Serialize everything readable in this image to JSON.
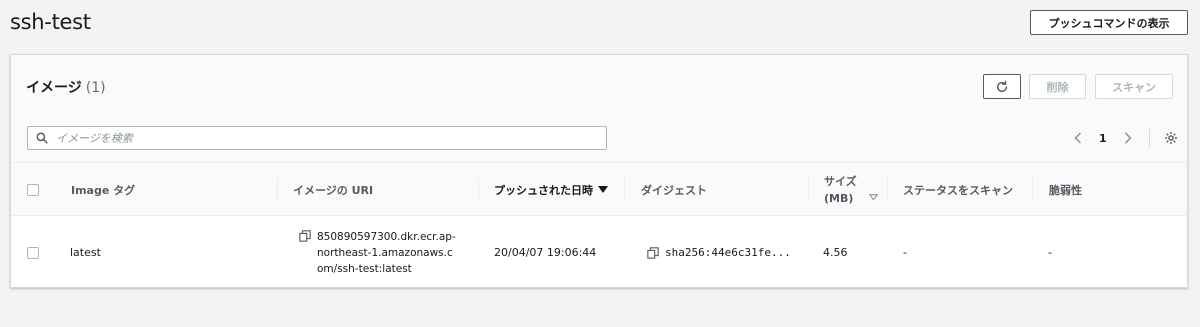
{
  "page": {
    "title": "ssh-test",
    "push_command_label": "プッシュコマンドの表示"
  },
  "panel": {
    "title": "イメージ",
    "count": "(1)",
    "delete_label": "削除",
    "scan_label": "スキャン",
    "search_placeholder": "イメージを検索",
    "page_number": "1"
  },
  "table": {
    "columns": {
      "image_tag": "Image タグ",
      "uri": "イメージの URI",
      "pushed_at": "プッシュされた日時",
      "digest": "ダイジェスト",
      "size_line1": "サイズ",
      "size_line2": "(MB)",
      "scan_status": "ステータスをスキャン",
      "vulnerabilities": "脆弱性"
    },
    "rows": [
      {
        "tag": "latest",
        "uri": "850890597300.dkr.ecr.ap-northeast-1.amazonaws.com/ssh-test:latest",
        "pushed_at": "20/04/07 19:06:44",
        "digest": "sha256:44e6c31fe...",
        "size": "4.56",
        "scan_status": "-",
        "vulnerabilities": "-"
      }
    ]
  },
  "icons": {
    "refresh": "refresh-icon",
    "search": "search-icon",
    "copy": "copy-icon",
    "sort_desc": "caret-down-icon",
    "sort_neutral": "sort-caret-icon",
    "prev": "chevron-left-icon",
    "next": "chevron-right-icon",
    "settings": "gear-icon"
  }
}
